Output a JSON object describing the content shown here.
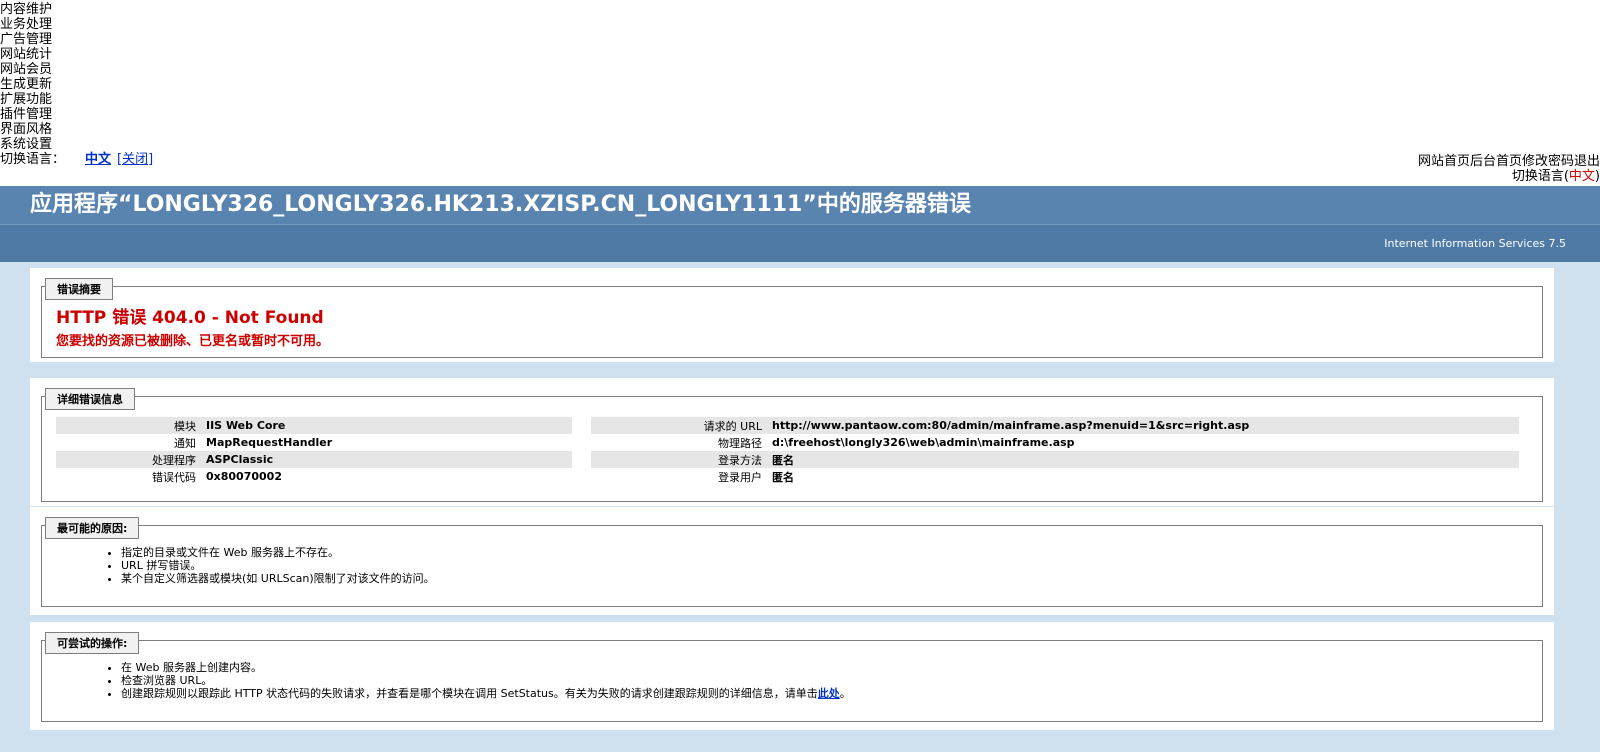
{
  "menu": {
    "items": [
      "内容维护",
      "业务处理",
      "广告管理",
      "网站统计",
      "网站会员",
      "生成更新",
      "扩展功能",
      "插件管理",
      "界面风格",
      "系统设置"
    ],
    "lang_label": "切换语言：",
    "lang_current": "中文",
    "lang_close": "[关闭]"
  },
  "topright": {
    "links": [
      "网站首页",
      "后台首页",
      "修改密码",
      "退出"
    ],
    "lang_prefix": "切换语言(",
    "lang_value": "中文",
    "lang_suffix": ")"
  },
  "iis": {
    "title": "应用程序“LONGLY326_LONGLY326.HK213.XZISP.CN_LONGLY1111”中的服务器错误",
    "server": "Internet Information Services 7.5",
    "summary": {
      "legend": "错误摘要",
      "code": "HTTP 错误 404.0 - Not Found",
      "desc": "您要找的资源已被删除、已更名或暂时不可用。"
    },
    "details": {
      "legend": "详细错误信息",
      "left": [
        {
          "k": "模块",
          "v": "IIS Web Core"
        },
        {
          "k": "通知",
          "v": "MapRequestHandler"
        },
        {
          "k": "处理程序",
          "v": "ASPClassic"
        },
        {
          "k": "错误代码",
          "v": "0x80070002"
        }
      ],
      "right": [
        {
          "k": "请求的 URL",
          "v": "http://www.pantaow.com:80/admin/mainframe.asp?menuid=1&src=right.asp"
        },
        {
          "k": "物理路径",
          "v": "d:\\freehost\\longly326\\web\\admin\\mainframe.asp"
        },
        {
          "k": "登录方法",
          "v": "匿名"
        },
        {
          "k": "登录用户",
          "v": "匿名"
        }
      ]
    },
    "causes": {
      "legend": "最可能的原因:",
      "items": [
        "指定的目录或文件在 Web 服务器上不存在。",
        "URL 拼写错误。",
        "某个自定义筛选器或模块(如 URLScan)限制了对该文件的访问。"
      ]
    },
    "actions": {
      "legend": "可尝试的操作:",
      "items": [
        "在 Web 服务器上创建内容。",
        "检查浏览器 URL。"
      ],
      "last_prefix": "创建跟踪规则以跟踪此 HTTP 状态代码的失败请求，并查看是哪个模块在调用 SetStatus。有关为失败的请求创建跟踪规则的详细信息，请单击",
      "last_link": "此处",
      "last_suffix": "。"
    }
  }
}
